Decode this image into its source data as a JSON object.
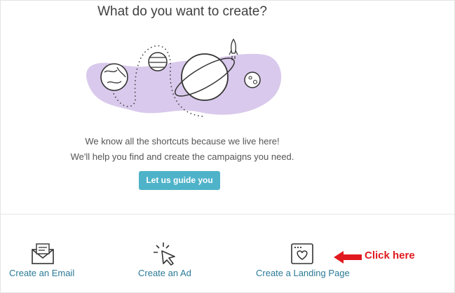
{
  "heading": "What do you want to create?",
  "subtext_line1": "We know all the shortcuts because we live here!",
  "subtext_line2": "We'll help you find and create the campaigns you need.",
  "guide_button": "Let us guide you",
  "options": [
    {
      "label": "Create an Email",
      "icon": "envelope-icon"
    },
    {
      "label": "Create an Ad",
      "icon": "cursor-click-icon"
    },
    {
      "label": "Create a Landing Page",
      "icon": "landing-page-icon"
    }
  ],
  "annotation": {
    "text": "Click here",
    "color": "#e0191e"
  },
  "colors": {
    "accent": "#4eb3c9",
    "blob": "#d9c9ec",
    "link": "#2a7a96"
  }
}
